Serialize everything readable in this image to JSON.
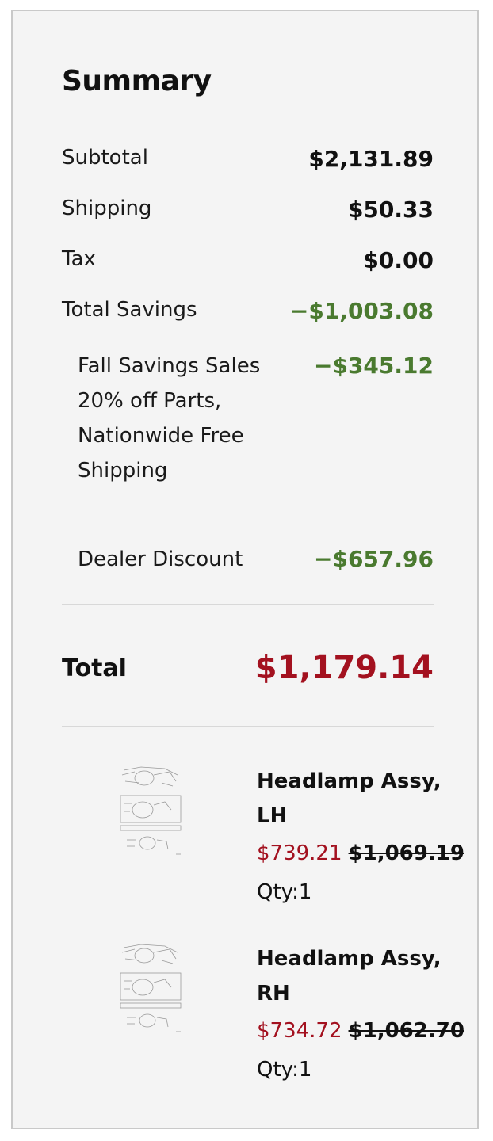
{
  "summary": {
    "title": "Summary",
    "rows": {
      "subtotal": {
        "label": "Subtotal",
        "value": "$2,131.89"
      },
      "shipping": {
        "label": "Shipping",
        "value": "$50.33"
      },
      "tax": {
        "label": "Tax",
        "value": "$0.00"
      },
      "savings": {
        "label": "Total Savings",
        "value": "−$1,003.08"
      }
    },
    "discounts": [
      {
        "label": "Fall Savings Sales 20% off Parts, Nationwide Free Shipping",
        "value": "−$345.12"
      },
      {
        "label": "Dealer Discount",
        "value": "−$657.96"
      }
    ],
    "total": {
      "label": "Total",
      "value": "$1,179.14"
    }
  },
  "items": [
    {
      "name": "Headlamp Assy, LH",
      "sale_price": "$739.21",
      "original_price": "$1,069.19",
      "qty": "Qty:1"
    },
    {
      "name": "Headlamp Assy, RH",
      "sale_price": "$734.72",
      "original_price": "$1,062.70",
      "qty": "Qty:1"
    }
  ],
  "colors": {
    "accent_red": "#a3111f",
    "savings_green": "#4a7a2f",
    "panel_bg": "#f4f4f4"
  }
}
